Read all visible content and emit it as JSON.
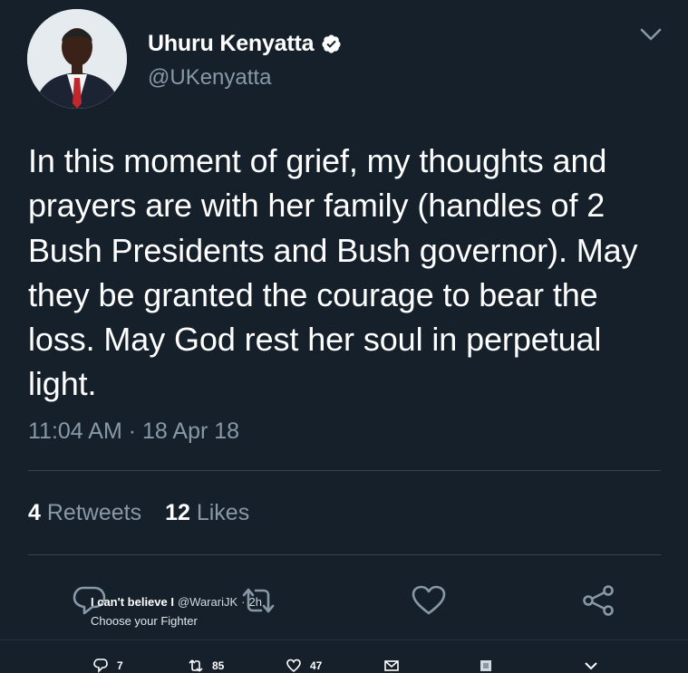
{
  "author": {
    "name": "Uhuru Kenyatta",
    "handle": "@UKenyatta",
    "verified": true,
    "avatar_icon": "profile-photo"
  },
  "tweet": {
    "text": "In this moment of grief, my thoughts and prayers are with her family (handles of 2 Bush Presidents and Bush governor). May they be granted the courage to bear the loss. May God rest her soul in perpetual light.",
    "time": "11:04 AM",
    "separator": "·",
    "date": "18 Apr 18"
  },
  "stats": {
    "retweets_count": "4",
    "retweets_label": "Retweets",
    "likes_count": "12",
    "likes_label": "Likes"
  },
  "overlay_tweet": {
    "name": "I can't believe I",
    "handle": "@WarariJK",
    "separator": "·",
    "time": "2h",
    "text": "Choose your Fighter"
  },
  "bottom_actions": {
    "replies": "7",
    "retweets": "85",
    "likes": "47"
  },
  "colors": {
    "background": "#15202b",
    "secondary_text": "#8899a6",
    "divider": "#38444d"
  }
}
